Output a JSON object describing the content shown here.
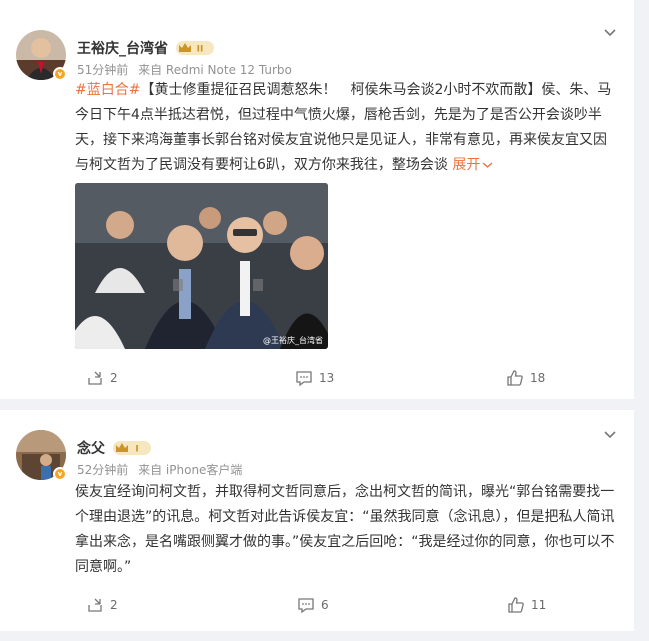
{
  "posts": [
    {
      "author": "王裕庆_台湾省",
      "vip_level": "II",
      "time": "51分钟前",
      "source": "来自 Redmi Note 12 Turbo",
      "topic": "#蓝白合#",
      "text": "【黄士修重提征召民调惹怒朱！　柯侯朱马会谈2小时不欢而散】侯、朱、马今日下午4点半抵达君悦，但过程中气愤火爆，唇枪舌剑，先是为了是否公开会谈吵半天，接下来鸿海董事长郭台铭对侯友宜说他只是见证人，非常有意见，再来侯友宜又因与柯文哲为了民调没有要柯让6趴，双方你来我往，整场会谈",
      "expand_label": "展开",
      "image_watermark": "@王裕庆_台湾省",
      "reposts": "2",
      "comments": "13",
      "likes": "18"
    },
    {
      "author": "念父",
      "vip_level": "I",
      "time": "52分钟前",
      "source": "来自 iPhone客户端",
      "text": "侯友宜经询问柯文哲，并取得柯文哲同意后，念出柯文哲的简讯，曝光“郭台铭需要找一个理由退选”的讯息。柯文哲对此告诉侯友宜：“虽然我同意（念讯息），但是把私人简讯拿出来念，是名嘴跟侧翼才做的事。”侯友宜之后回呛：“我是经过你的同意，你也可以不同意啊。”",
      "reposts": "2",
      "comments": "6",
      "likes": "11"
    }
  ],
  "colors": {
    "accent": "#eb7340",
    "meta": "#939393",
    "background": "#f1f2f5"
  },
  "icons": [
    "chevron-down-icon",
    "repost-icon",
    "comment-icon",
    "like-icon",
    "verified-badge-icon",
    "vip-crown-icon"
  ]
}
